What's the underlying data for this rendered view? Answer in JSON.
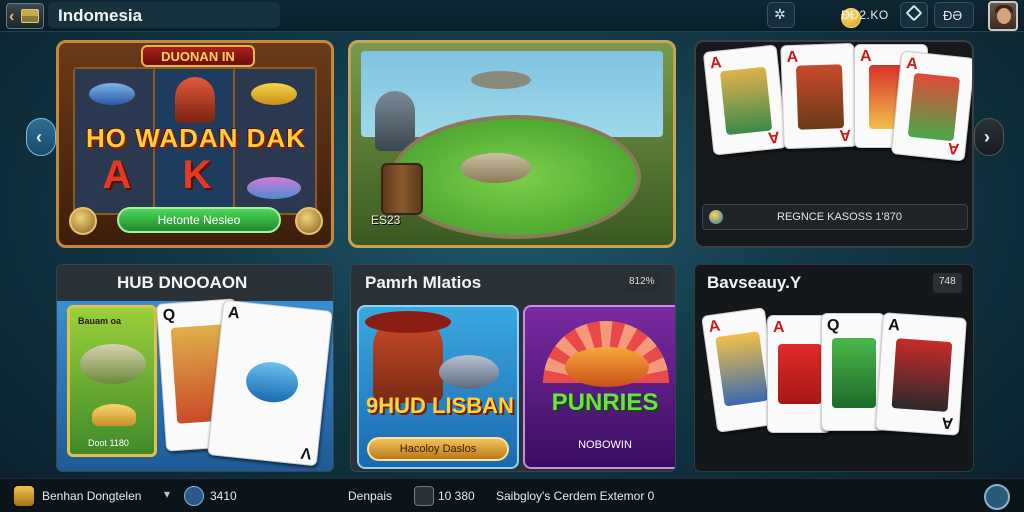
{
  "topbar": {
    "region": "Indomesia",
    "coins": "ĐĐ2.KO",
    "menu_label": "ĐƏ"
  },
  "carousel": {
    "slot": {
      "banner": "DUONAN IN",
      "headline": "HO WADAN DAK",
      "button": "Hetonte Nesleo"
    },
    "fishing": {
      "caption": "ES23"
    },
    "cards": {
      "caption": "REGNCE KASOSS 1'870"
    }
  },
  "sections": [
    {
      "title": "HUB DNOOAON"
    },
    {
      "title": "Pamrh Mlatios",
      "badge": "812%",
      "tiles": [
        {
          "logo": "9HUD LISBAN",
          "button": "Hacoloy Daslos"
        },
        {
          "logo": "PUNRIES",
          "subtitle": "NOBOWIN"
        }
      ]
    },
    {
      "title": "Bavseauy.Y",
      "badge": "748"
    }
  ],
  "bottombar": {
    "left_label": "Benhan Dongtelen",
    "balance": "3410",
    "nav_label": "Denpais",
    "count": "10 380",
    "promo": "Saibgloy's Cerdem Extemor 0"
  },
  "icons": {
    "back": "back-chevron-icon",
    "settings": "settings-icon",
    "coin": "coin-icon",
    "tag": "tag-icon",
    "avatar": "avatar"
  }
}
